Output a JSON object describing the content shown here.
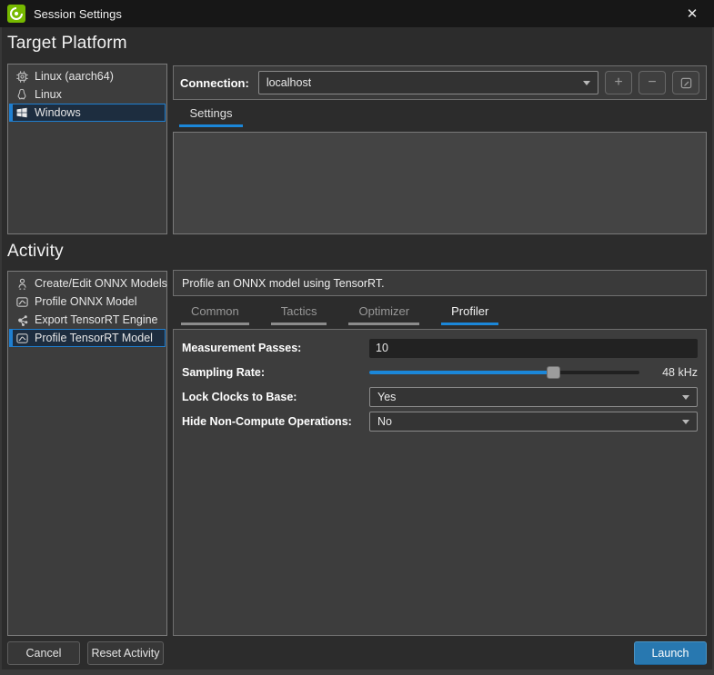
{
  "window": {
    "title": "Session Settings",
    "close_glyph": "✕"
  },
  "colors": {
    "accent_blue": "#1b87d9",
    "nvidia_green": "#76b900",
    "launch_button": "#2878b0",
    "panel_bg": "#3d3d3d"
  },
  "target_platform": {
    "heading": "Target Platform",
    "items": [
      {
        "label": "Linux (aarch64)",
        "icon": "chip-icon",
        "selected": false
      },
      {
        "label": "Linux",
        "icon": "penguin-icon",
        "selected": false
      },
      {
        "label": "Windows",
        "icon": "windows-icon",
        "selected": true
      }
    ]
  },
  "connection": {
    "label": "Connection:",
    "value": "localhost",
    "add_glyph": "+",
    "remove_glyph": "−"
  },
  "settings_tab": {
    "label": "Settings"
  },
  "activity": {
    "heading": "Activity",
    "items": [
      {
        "label": "Create/Edit ONNX Models",
        "icon": "person-icon",
        "selected": false
      },
      {
        "label": "Profile ONNX Model",
        "icon": "chart-icon",
        "selected": false
      },
      {
        "label": "Export TensorRT Engine",
        "icon": "network-icon",
        "selected": false
      },
      {
        "label": "Profile TensorRT Model",
        "icon": "chart-icon",
        "selected": true
      }
    ],
    "description": "Profile an ONNX model using TensorRT."
  },
  "tabs": [
    {
      "label": "Common",
      "active": false
    },
    {
      "label": "Tactics",
      "active": false
    },
    {
      "label": "Optimizer",
      "active": false
    },
    {
      "label": "Profiler",
      "active": true
    }
  ],
  "profiler_form": {
    "measurement_passes": {
      "label": "Measurement Passes:",
      "value": "10"
    },
    "sampling_rate": {
      "label": "Sampling Rate:",
      "value_label": "48 kHz",
      "slider_percent": 68
    },
    "lock_clocks": {
      "label": "Lock Clocks to Base:",
      "value": "Yes"
    },
    "hide_non_compute": {
      "label": "Hide Non-Compute Operations:",
      "value": "No"
    }
  },
  "footer": {
    "cancel": "Cancel",
    "reset": "Reset Activity",
    "launch": "Launch"
  }
}
